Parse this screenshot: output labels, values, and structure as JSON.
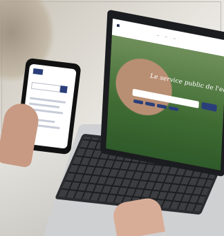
{
  "scene": {
    "description_alt": "Person holding a smartphone and using a laptop showing a public water service website",
    "laptop_site": {
      "hero_title": "Le service public de l'eau"
    }
  }
}
